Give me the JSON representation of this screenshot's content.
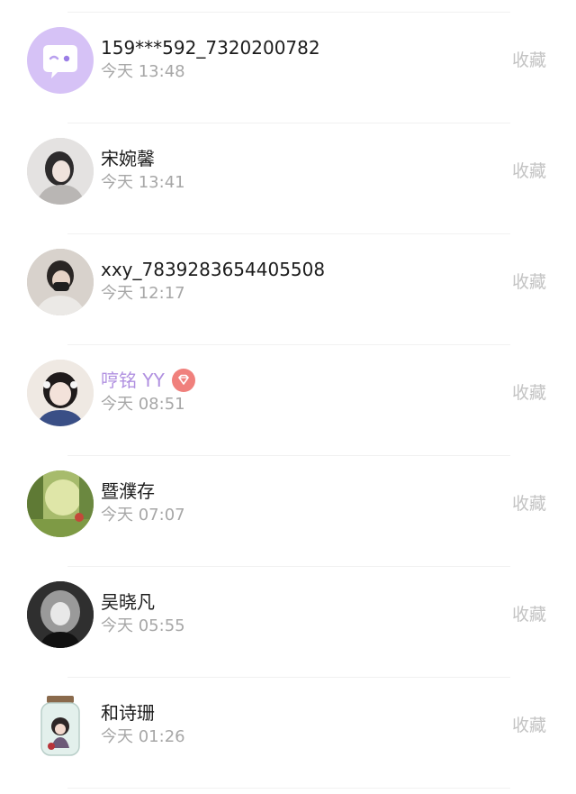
{
  "visitors": [
    {
      "name": "159***592_7320200782",
      "time": "今天 13:48",
      "action": "收藏",
      "avatar": "app-logo-avatar",
      "vip": false
    },
    {
      "name": "宋婉馨",
      "time": "今天 13:41",
      "action": "收藏",
      "avatar": "user-photo-avatar",
      "vip": false
    },
    {
      "name": "xxy_7839283654405508",
      "time": "今天 12:17",
      "action": "收藏",
      "avatar": "user-photo-avatar",
      "vip": false
    },
    {
      "name": "哼铭 YY",
      "time": "今天 08:51",
      "action": "收藏",
      "avatar": "user-photo-avatar",
      "vip": true,
      "badge": "diamond-icon"
    },
    {
      "name": "暨濮存",
      "time": "今天 07:07",
      "action": "收藏",
      "avatar": "forest-photo-avatar",
      "vip": false
    },
    {
      "name": "吴晓凡",
      "time": "今天 05:55",
      "action": "收藏",
      "avatar": "user-photo-avatar",
      "vip": false
    },
    {
      "name": "和诗珊",
      "time": "今天 01:26",
      "action": "收藏",
      "avatar": "jar-doll-avatar",
      "vip": false
    }
  ],
  "colors": {
    "name_text": "#1c1c1c",
    "vip_name": "#b090e0",
    "time_text": "#a7a7a7",
    "action_text": "#c3c3c3",
    "vip_badge": "#f0807c",
    "app_logo_bg": "#d6c2f6"
  }
}
